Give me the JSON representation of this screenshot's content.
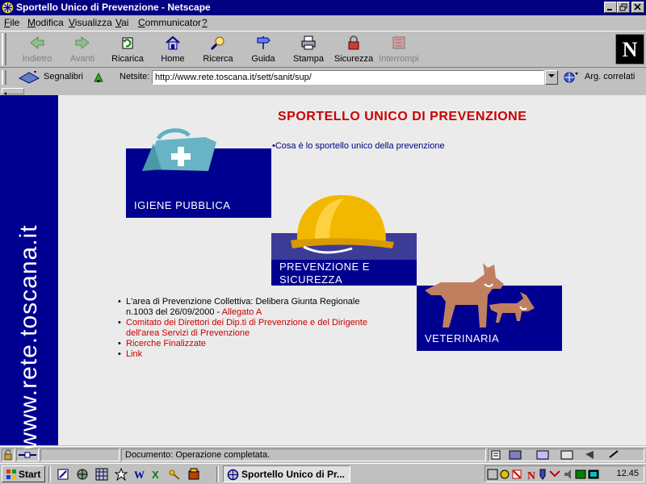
{
  "window": {
    "title": "Sportello Unico di Prevenzione - Netscape"
  },
  "menu": [
    {
      "label": "File",
      "u": "F",
      "rest": "ile"
    },
    {
      "label": "Modifica",
      "u": "M",
      "rest": "odifica"
    },
    {
      "label": "Visualizza",
      "u": "V",
      "rest": "isualizza"
    },
    {
      "label": "Vai",
      "u": "V",
      "rest": "ai"
    },
    {
      "label": "Communicator",
      "u": "C",
      "rest": "ommunicator"
    },
    {
      "label": "?",
      "u": "?",
      "rest": ""
    }
  ],
  "toolbar": {
    "back": "Indietro",
    "forward": "Avanti",
    "reload": "Ricarica",
    "home": "Home",
    "search": "Ricerca",
    "guide": "Guida",
    "print": "Stampa",
    "security": "Sicurezza",
    "stop": "Interrompi"
  },
  "location": {
    "bookmarks_label": "Segnalibri",
    "site_label": "Netsite:",
    "url": "http://www.rete.toscana.it/sett/sanit/sup/",
    "related_label": "Arg. correlati"
  },
  "page": {
    "sidebar_text": "www.rete.toscana.it",
    "title": "SPORTELLO UNICO DI PREVENZIONE",
    "intro_link": "Cosa è lo sportello unico della prevenzione",
    "tiles": {
      "igiene": "IGIENE PUBBLICA",
      "prevenzione_1": "PREVENZIONE E",
      "prevenzione_2": "SICUREZZA",
      "veterinaria": "VETERINARIA"
    },
    "list": {
      "item1_line1": "L'area di Prevenzione Collettiva: Delibera Giunta Regionale",
      "item1_line2": "n.1003 del 26/09/2000 - ",
      "item1_link": "Allegato A",
      "item2_line1": "Comitato dei Direttori dei Dip.ti di Prevenzione e del Dirigente",
      "item2_line2": "dell'area Servizi di Prevenzione",
      "item3": "Ricerche Finalizzate",
      "item4": "Link"
    }
  },
  "status": {
    "text": "Documento: Operazione completata."
  },
  "taskbar": {
    "start": "Start",
    "task": "Sportello Unico di Pr...",
    "clock": "12.45"
  },
  "colors": {
    "title_red": "#c80000",
    "tile_blue": "#000090",
    "band_purple": "#3c3c96",
    "titlebar": "#000080"
  }
}
